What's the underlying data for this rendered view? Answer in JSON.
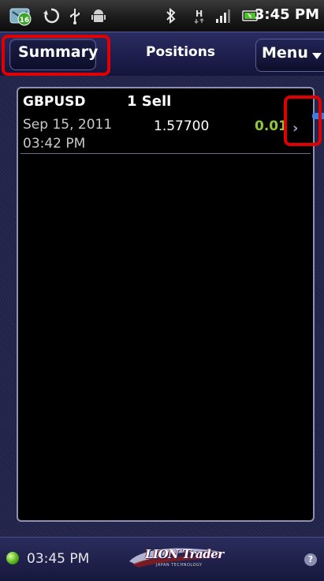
{
  "status_bar": {
    "notification_count": "16",
    "time": "3:45 PM",
    "icons": [
      "app-badge-icon",
      "sync-icon",
      "usb-icon",
      "android-debug-icon",
      "bluetooth-icon",
      "data-h-icon",
      "signal-icon",
      "battery-icon"
    ]
  },
  "header": {
    "summary_tab": "Summary",
    "positions_tab": "Positions",
    "menu_label": "Menu"
  },
  "positions": [
    {
      "symbol": "GBPUSD",
      "side": "1 Sell",
      "date": "Sep 15, 2011",
      "time": "03:42 PM",
      "price": "1.57700",
      "pl": "0.01"
    }
  ],
  "footer": {
    "time": "03:45 PM",
    "logo_text": "LION Trader",
    "logo_subtext": "JAPAN TECHNOLOGY",
    "help": "?"
  },
  "colors": {
    "header_bg": "#1c1d4a",
    "pl_positive": "#8fc83a",
    "annotation": "#e00000",
    "connection_ok": "#57b41c"
  }
}
